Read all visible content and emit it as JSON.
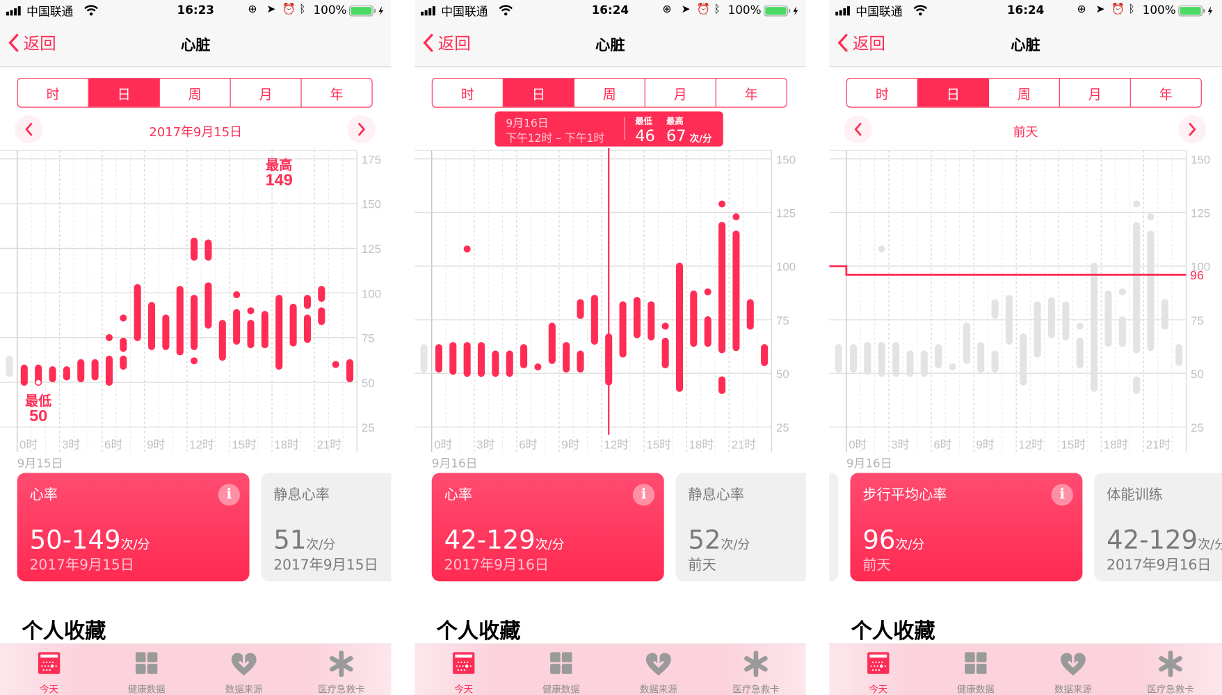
{
  "colors": {
    "accent": "#ff2d55",
    "bar_gray": "#e3e3e6",
    "battery": "#4cd964"
  },
  "panels": [
    {
      "status": {
        "carrier": "中国联通",
        "time": "16:23",
        "battery": "100%"
      },
      "nav": {
        "back": "返回",
        "title": "心脏"
      },
      "segments": [
        "时",
        "日",
        "周",
        "月",
        "年"
      ],
      "selected_segment": 1,
      "date_label": "2017年9月15日",
      "chart_date": "9月15日",
      "chart_data": {
        "type": "range-bar",
        "ylim": [
          25,
          175
        ],
        "yticks": [
          175,
          150,
          125,
          100,
          75,
          50,
          25
        ],
        "xticks": [
          "0时",
          "3时",
          "6时",
          "9时",
          "12时",
          "15时",
          "18时",
          "21时"
        ],
        "previous_day_edge": [
          55,
          63
        ],
        "hours": [
          [
            [
              50,
              58
            ]
          ],
          [
            [
              50,
              58
            ]
          ],
          [
            [
              52,
              57
            ]
          ],
          [
            [
              53,
              57
            ]
          ],
          [
            [
              52,
              61
            ]
          ],
          [
            [
              53,
              61
            ]
          ],
          [
            [
              50,
              63
            ],
            [
              75,
              75
            ]
          ],
          [
            [
              86,
              86
            ],
            [
              69,
              73
            ],
            [
              59,
              63
            ]
          ],
          [
            [
              75,
              103
            ]
          ],
          [
            [
              70,
              93
            ]
          ],
          [
            [
              70,
              86
            ]
          ],
          [
            [
              67,
              102
            ]
          ],
          [
            [
              120,
              129
            ],
            [
              70,
              97
            ],
            [
              62,
              62
            ]
          ],
          [
            [
              120,
              128
            ],
            [
              82,
              104
            ]
          ],
          [
            [
              64,
              83
            ]
          ],
          [
            [
              99,
              99
            ],
            [
              73,
              89
            ]
          ],
          [
            [
              90,
              90
            ],
            [
              71,
              83
            ]
          ],
          [
            [
              71,
              88
            ]
          ],
          [
            [
              59,
              97
            ]
          ],
          [
            [
              72,
              92
            ]
          ],
          [
            [
              93,
              97
            ],
            [
              74,
              86
            ]
          ],
          [
            [
              97,
              102
            ],
            [
              84,
              90
            ]
          ],
          [
            [
              60,
              60
            ]
          ],
          [
            [
              52,
              61
            ]
          ]
        ],
        "annotations": [
          {
            "label": "最低",
            "value": "50",
            "hour": 1,
            "y": 50
          },
          {
            "label": "最高",
            "value": "149",
            "hour": 18,
            "y": 149
          }
        ]
      },
      "cards": [
        {
          "title": "心率",
          "value": "50-149",
          "unit": "次/分",
          "date": "2017年9月15日",
          "style": "red"
        },
        {
          "title": "静息心率",
          "value": "51",
          "unit": "次/分",
          "date": "2017年9月15日",
          "style": "gray"
        }
      ],
      "favorites": "个人收藏",
      "tabs": [
        "今天",
        "健康数据",
        "数据来源",
        "医疗急救卡"
      ]
    },
    {
      "status": {
        "carrier": "中国联通",
        "time": "16:24",
        "battery": "100%"
      },
      "nav": {
        "back": "返回",
        "title": "心脏"
      },
      "segments": [
        "时",
        "日",
        "周",
        "月",
        "年"
      ],
      "selected_segment": 1,
      "date_label": "",
      "chart_date": "9月16日",
      "tooltip": {
        "date": "9月16日",
        "range": "下午12时 – 下午1时",
        "min_label": "最低",
        "max_label": "最高",
        "min": "46",
        "max": "67",
        "unit": "次/分",
        "hour": 12
      },
      "chart_data": {
        "type": "range-bar",
        "ylim": [
          25,
          150
        ],
        "yticks": [
          150,
          125,
          100,
          75,
          50,
          25
        ],
        "xticks": [
          "0时",
          "3时",
          "6时",
          "9时",
          "12时",
          "15时",
          "18时",
          "21时"
        ],
        "previous_day_edge": [
          52,
          62
        ],
        "hours": [
          [
            [
              52,
              62
            ]
          ],
          [
            [
              51,
              63
            ]
          ],
          [
            [
              50,
              63
            ],
            [
              108,
              108
            ]
          ],
          [
            [
              50,
              63
            ]
          ],
          [
            [
              50,
              59
            ]
          ],
          [
            [
              50,
              59
            ]
          ],
          [
            [
              54,
              62
            ]
          ],
          [
            [
              53,
              53
            ]
          ],
          [
            [
              56,
              72
            ]
          ],
          [
            [
              52,
              63
            ]
          ],
          [
            [
              77,
              83
            ],
            [
              52,
              59
            ]
          ],
          [
            [
              65,
              85
            ]
          ],
          [
            [
              46,
              67
            ]
          ],
          [
            [
              59,
              82
            ]
          ],
          [
            [
              68,
              84
            ]
          ],
          [
            [
              67,
              82
            ]
          ],
          [
            [
              72,
              72
            ],
            [
              54,
              65
            ]
          ],
          [
            [
              43,
              100
            ]
          ],
          [
            [
              64,
              87
            ]
          ],
          [
            [
              88,
              88
            ],
            [
              64,
              75
            ]
          ],
          [
            [
              129,
              129
            ],
            [
              61,
              119
            ],
            [
              42,
              47
            ]
          ],
          [
            [
              123,
              123
            ],
            [
              62,
              115
            ]
          ],
          [
            [
              72,
              83
            ]
          ],
          [
            [
              55,
              62
            ]
          ]
        ]
      },
      "cards": [
        {
          "title": "心率",
          "value": "42-129",
          "unit": "次/分",
          "date": "2017年9月16日",
          "style": "red"
        },
        {
          "title": "静息心率",
          "value": "52",
          "unit": "次/分",
          "date": "前天",
          "style": "gray"
        }
      ],
      "favorites": "个人收藏",
      "tabs": [
        "今天",
        "健康数据",
        "数据来源",
        "医疗急救卡"
      ]
    },
    {
      "status": {
        "carrier": "中国联通",
        "time": "16:24",
        "battery": "100%"
      },
      "nav": {
        "back": "返回",
        "title": "心脏"
      },
      "segments": [
        "时",
        "日",
        "周",
        "月",
        "年"
      ],
      "selected_segment": 1,
      "date_label": "前天",
      "chart_date": "9月16日",
      "chart_data": {
        "type": "range-bar",
        "ylim": [
          25,
          150
        ],
        "yticks": [
          150,
          125,
          100,
          75,
          50,
          25
        ],
        "xticks": [
          "0时",
          "3时",
          "6时",
          "9时",
          "12时",
          "15时",
          "18时",
          "21时"
        ],
        "previous_day_edge": [
          52,
          62
        ],
        "grayed": true,
        "reference_line": {
          "value": 96,
          "label": "96",
          "previous_value": 100
        },
        "hours": [
          [
            [
              52,
              62
            ]
          ],
          [
            [
              51,
              63
            ]
          ],
          [
            [
              50,
              63
            ],
            [
              108,
              108
            ]
          ],
          [
            [
              50,
              63
            ]
          ],
          [
            [
              50,
              59
            ]
          ],
          [
            [
              50,
              59
            ]
          ],
          [
            [
              54,
              62
            ]
          ],
          [
            [
              53,
              53
            ]
          ],
          [
            [
              56,
              72
            ]
          ],
          [
            [
              52,
              63
            ]
          ],
          [
            [
              77,
              83
            ],
            [
              52,
              59
            ]
          ],
          [
            [
              65,
              85
            ]
          ],
          [
            [
              46,
              67
            ]
          ],
          [
            [
              59,
              82
            ]
          ],
          [
            [
              68,
              84
            ]
          ],
          [
            [
              67,
              82
            ]
          ],
          [
            [
              72,
              72
            ],
            [
              54,
              65
            ]
          ],
          [
            [
              43,
              100
            ]
          ],
          [
            [
              64,
              87
            ]
          ],
          [
            [
              88,
              88
            ],
            [
              64,
              75
            ]
          ],
          [
            [
              129,
              129
            ],
            [
              61,
              119
            ],
            [
              42,
              47
            ]
          ],
          [
            [
              123,
              123
            ],
            [
              62,
              115
            ]
          ],
          [
            [
              72,
              83
            ]
          ],
          [
            [
              55,
              62
            ]
          ]
        ]
      },
      "cards": [
        {
          "title": "步行平均心率",
          "value": "96",
          "unit": "次/分",
          "date": "前天",
          "style": "red"
        },
        {
          "title": "体能训练",
          "value": "42-129",
          "unit": "次/分",
          "date": "2017年9月16日",
          "style": "gray"
        }
      ],
      "favorites": "个人收藏",
      "tabs": [
        "今天",
        "健康数据",
        "数据来源",
        "医疗急救卡"
      ]
    }
  ]
}
